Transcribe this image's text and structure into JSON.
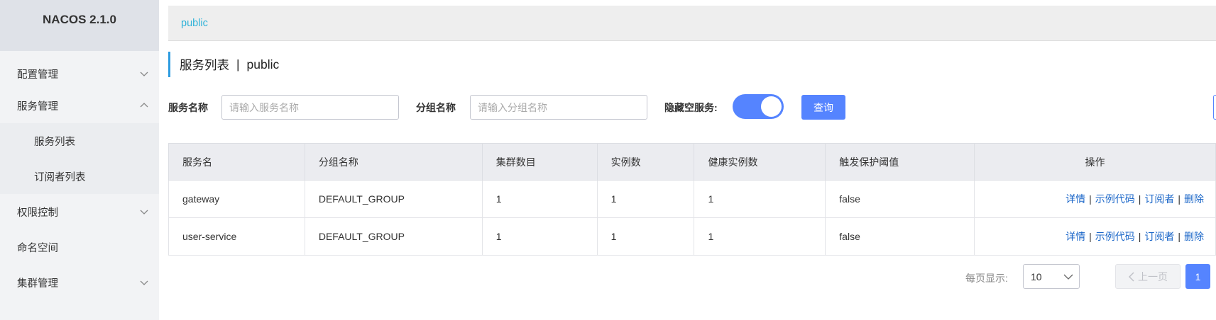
{
  "brand": "NACOS 2.1.0",
  "sidebar": {
    "items": [
      {
        "label": "配置管理",
        "icon": "chevron-down-icon"
      },
      {
        "label": "服务管理",
        "icon": "chevron-up-icon"
      },
      {
        "label": "服务列表"
      },
      {
        "label": "订阅者列表"
      },
      {
        "label": "权限控制",
        "icon": "chevron-down-icon"
      },
      {
        "label": "命名空间"
      },
      {
        "label": "集群管理",
        "icon": "chevron-down-icon"
      }
    ]
  },
  "namespace_bar": {
    "link": "public"
  },
  "page": {
    "title": "服务列表",
    "separator": "|",
    "namespace": "public"
  },
  "filters": {
    "service_name_label": "服务名称",
    "service_name_placeholder": "请输入服务名称",
    "group_name_label": "分组名称",
    "group_name_placeholder": "请输入分组名称",
    "hide_empty_label": "隐藏空服务:",
    "hide_empty_on": true,
    "query_button": "查询"
  },
  "table": {
    "headers": [
      "服务名",
      "分组名称",
      "集群数目",
      "实例数",
      "健康实例数",
      "触发保护阈值",
      "操作"
    ],
    "rows": [
      [
        "gateway",
        "DEFAULT_GROUP",
        "1",
        "1",
        "1",
        "false"
      ],
      [
        "user-service",
        "DEFAULT_GROUP",
        "1",
        "1",
        "1",
        "false"
      ]
    ],
    "actions": [
      "详情",
      "示例代码",
      "订阅者",
      "删除"
    ],
    "action_separator": "|"
  },
  "pagination": {
    "page_size_label": "每页显示:",
    "page_size": "10",
    "prev_label": "上一页",
    "current_page": "1"
  },
  "colors": {
    "primary": "#5584ff",
    "link": "#1a66c8",
    "accent_bar": "#2e9ce0"
  }
}
